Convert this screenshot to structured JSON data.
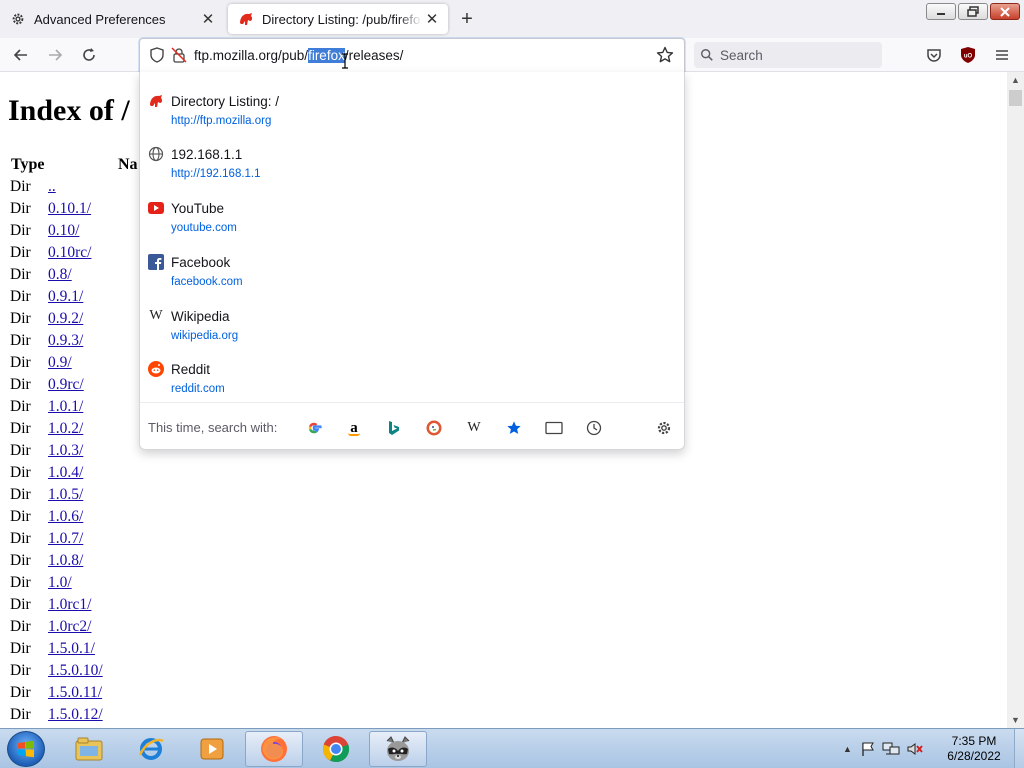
{
  "browser": {
    "tabs": [
      {
        "label": "Advanced Preferences",
        "icon": "gear-icon",
        "active": false
      },
      {
        "label": "Directory Listing: /pub/firefox/releases/",
        "icon": "mozilla-dino-icon",
        "active": true
      }
    ],
    "url": {
      "before": "ftp.mozilla.org/pub/",
      "selected": "firefox",
      "after": "/releases/"
    },
    "search_placeholder": "Search"
  },
  "page": {
    "heading": "Index of /",
    "col_type": "Type",
    "col_name": "Na",
    "rows": [
      {
        "type": "Dir",
        "name": ".."
      },
      {
        "type": "Dir",
        "name": "0.10.1/"
      },
      {
        "type": "Dir",
        "name": "0.10/"
      },
      {
        "type": "Dir",
        "name": "0.10rc/"
      },
      {
        "type": "Dir",
        "name": "0.8/"
      },
      {
        "type": "Dir",
        "name": "0.9.1/"
      },
      {
        "type": "Dir",
        "name": "0.9.2/"
      },
      {
        "type": "Dir",
        "name": "0.9.3/"
      },
      {
        "type": "Dir",
        "name": "0.9/"
      },
      {
        "type": "Dir",
        "name": "0.9rc/"
      },
      {
        "type": "Dir",
        "name": "1.0.1/"
      },
      {
        "type": "Dir",
        "name": "1.0.2/"
      },
      {
        "type": "Dir",
        "name": "1.0.3/"
      },
      {
        "type": "Dir",
        "name": "1.0.4/"
      },
      {
        "type": "Dir",
        "name": "1.0.5/"
      },
      {
        "type": "Dir",
        "name": "1.0.6/"
      },
      {
        "type": "Dir",
        "name": "1.0.7/"
      },
      {
        "type": "Dir",
        "name": "1.0.8/"
      },
      {
        "type": "Dir",
        "name": "1.0/"
      },
      {
        "type": "Dir",
        "name": "1.0rc1/"
      },
      {
        "type": "Dir",
        "name": "1.0rc2/"
      },
      {
        "type": "Dir",
        "name": "1.5.0.1/"
      },
      {
        "type": "Dir",
        "name": "1.5.0.10/"
      },
      {
        "type": "Dir",
        "name": "1.5.0.11/"
      },
      {
        "type": "Dir",
        "name": "1.5.0.12/"
      }
    ]
  },
  "dropdown": {
    "suggestions": [
      {
        "title": "Directory Listing: /",
        "url": "http://ftp.mozilla.org",
        "icon": "mozilla-dino-icon"
      },
      {
        "title": "192.168.1.1",
        "url": "http://192.168.1.1",
        "icon": "globe-icon"
      },
      {
        "title": "YouTube",
        "url": "youtube.com",
        "icon": "youtube-icon"
      },
      {
        "title": "Facebook",
        "url": "facebook.com",
        "icon": "facebook-icon"
      },
      {
        "title": "Wikipedia",
        "url": "wikipedia.org",
        "icon": "wikipedia-icon"
      },
      {
        "title": "Reddit",
        "url": "reddit.com",
        "icon": "reddit-icon"
      }
    ],
    "search_with_label": "This time, search with:",
    "engines": [
      "google-icon",
      "amazon-icon",
      "bing-icon",
      "duckduckgo-icon",
      "wikipedia-icon",
      "bookmarks-icon",
      "tabs-icon",
      "history-icon"
    ]
  },
  "taskbar": {
    "time": "7:35 PM",
    "date": "6/28/2022",
    "apps": [
      "explorer-icon",
      "internet-explorer-icon",
      "media-player-icon",
      "firefox-icon",
      "chrome-icon",
      "raccoon-app-icon"
    ]
  },
  "colors": {
    "accent": "#0061e0",
    "link": "#1a0dab",
    "selection": "#3f7dd9",
    "mozilla_red": "#e22b1c"
  }
}
